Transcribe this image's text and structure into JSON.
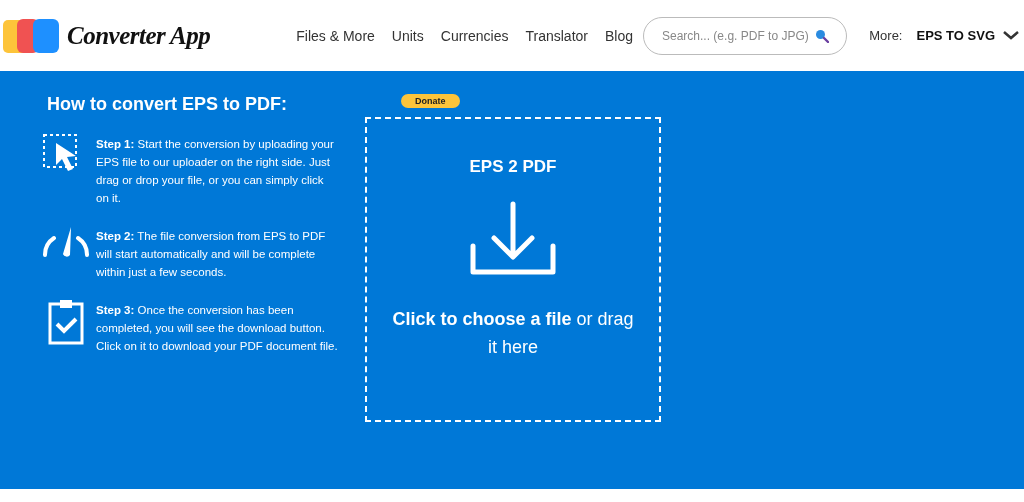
{
  "header": {
    "logo_text": "Converter App",
    "nav": [
      "Files & More",
      "Units",
      "Currencies",
      "Translator",
      "Blog"
    ],
    "search": {
      "placeholder": "Search... (e.g. PDF to JPG)"
    },
    "more_label": "More:",
    "more_value": "EPS TO SVG"
  },
  "howto": {
    "title": "How to convert EPS to PDF:",
    "steps": [
      {
        "kind": "cursor",
        "text": "**Step 1:** Start the conversion by uploading your EPS file to our uploader on the right side. Just drag or drop your file, or you can simply click on it."
      },
      {
        "kind": "gauge",
        "text": "**Step 2:** The file conversion from EPS to PDF will start automatically and will be complete within just a few seconds."
      },
      {
        "kind": "clipboard",
        "text": "**Step 3:** Once the conversion has been completed, you will see the download button. Click on it to download your PDF document file."
      }
    ]
  },
  "donate": "Donate",
  "dropzone": {
    "title": "EPS 2 PDF",
    "text": "**Click to choose a file** or drag it here"
  }
}
